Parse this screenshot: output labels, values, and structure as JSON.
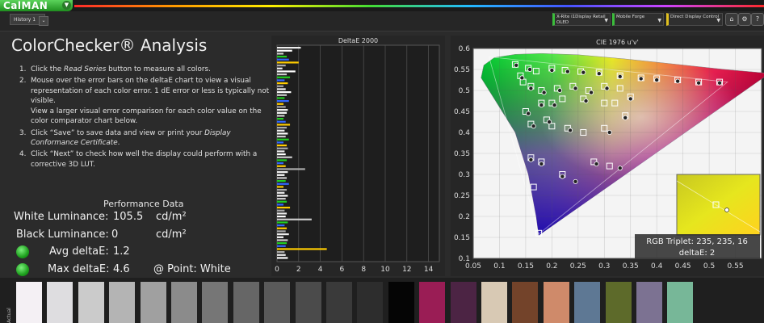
{
  "app": {
    "logo": "CalMAN",
    "history_tab": "History 1",
    "dropdowns": [
      {
        "label": "X-Rite i1Display Retail",
        "sub": "OLED"
      },
      {
        "label": "Mobile Forge",
        "sub": ""
      },
      {
        "label": "Direct Display Control",
        "sub": ""
      }
    ],
    "icons": [
      "home-icon",
      "settings-icon",
      "help-icon"
    ]
  },
  "page": {
    "title": "ColorChecker® Analysis",
    "steps": [
      {
        "num": "1.",
        "html": "Click the <i>Read Series</i> button to measure all colors."
      },
      {
        "num": "2.",
        "html": "Mouse over the error bars on the deltaE chart to view a visual representation of each color error. 1 dE error or less is typically not visible.<br>View a larger visual error comparison for each color value on the color comparator chart below."
      },
      {
        "num": "3.",
        "html": "Click “Save” to save data and view or print your <i>Display Conformance Certificate</i>."
      },
      {
        "num": "4.",
        "html": "Click “Next” to check how well the display could perform with a corrective 3D LUT."
      }
    ]
  },
  "performance": {
    "title": "Performance Data",
    "white_label": "White Luminance:",
    "white_value": "105.5",
    "white_unit": "cd/m²",
    "black_label": "Black Luminance:",
    "black_value": "0",
    "black_unit": "cd/m²",
    "avg_label": "Avg deltaE:",
    "avg_value": "1.2",
    "max_label": "Max deltaE:",
    "max_value": "4.6",
    "point_label": "@ Point: White",
    "status_color": "#22b022"
  },
  "chart_data": [
    {
      "type": "bar",
      "orientation": "horizontal",
      "title": "DeltaE 2000",
      "xlim": [
        0,
        15
      ],
      "xticks": [
        "0",
        "2",
        "4",
        "6",
        "8",
        "10",
        "12",
        "14"
      ],
      "values": [
        2.2,
        1.4,
        0.6,
        0.9,
        1.1,
        2.0,
        0.8,
        0.5,
        1.7,
        0.9,
        1.2,
        0.7,
        1.0,
        0.6,
        0.8,
        1.3,
        0.9,
        0.7,
        1.1,
        0.6,
        0.8,
        1.0,
        0.9,
        0.7,
        0.6,
        0.8,
        1.2,
        0.9,
        0.7,
        1.0,
        0.8,
        1.1,
        0.6,
        0.9,
        1.0,
        0.7,
        0.8,
        1.4,
        0.9,
        0.6,
        0.8,
        2.6,
        1.0,
        0.7,
        0.9,
        0.8,
        1.1,
        0.6,
        0.9,
        0.7,
        1.0,
        0.8,
        0.9,
        0.6,
        1.2,
        0.7,
        0.9,
        0.8,
        3.2,
        1.0,
        0.7,
        0.9,
        0.8,
        1.1,
        0.6,
        1.0,
        0.9,
        0.8,
        4.6,
        0.7,
        0.8,
        1.0
      ],
      "bar_colors": [
        "#eeeeee",
        "#ffffff",
        "#cccccc",
        "#22cc22",
        "#3366ff",
        "#ffcc00",
        "#aaaaaa"
      ]
    },
    {
      "type": "scatter",
      "title": "CIE 1976 u'v'",
      "xlim": [
        0.05,
        0.6
      ],
      "ylim": [
        0.1,
        0.6
      ],
      "xticks": [
        "0.05",
        "0.1",
        "0.15",
        "0.2",
        "0.25",
        "0.3",
        "0.35",
        "0.4",
        "0.45",
        "0.5",
        "0.55"
      ],
      "yticks": [
        "0.6",
        "0.55",
        "0.5",
        "0.45",
        "0.4",
        "0.35",
        "0.3",
        "0.25",
        "0.2",
        "0.15",
        "0.1"
      ],
      "targets": [
        [
          0.13,
          0.562
        ],
        [
          0.155,
          0.553
        ],
        [
          0.17,
          0.546
        ],
        [
          0.2,
          0.553
        ],
        [
          0.225,
          0.548
        ],
        [
          0.255,
          0.545
        ],
        [
          0.29,
          0.543
        ],
        [
          0.33,
          0.535
        ],
        [
          0.37,
          0.53
        ],
        [
          0.4,
          0.528
        ],
        [
          0.44,
          0.525
        ],
        [
          0.48,
          0.52
        ],
        [
          0.52,
          0.52
        ],
        [
          0.14,
          0.535
        ],
        [
          0.145,
          0.52
        ],
        [
          0.16,
          0.51
        ],
        [
          0.18,
          0.5
        ],
        [
          0.21,
          0.505
        ],
        [
          0.24,
          0.51
        ],
        [
          0.27,
          0.5
        ],
        [
          0.3,
          0.51
        ],
        [
          0.33,
          0.505
        ],
        [
          0.35,
          0.485
        ],
        [
          0.18,
          0.47
        ],
        [
          0.2,
          0.47
        ],
        [
          0.22,
          0.48
        ],
        [
          0.26,
          0.48
        ],
        [
          0.3,
          0.47
        ],
        [
          0.32,
          0.47
        ],
        [
          0.15,
          0.45
        ],
        [
          0.16,
          0.42
        ],
        [
          0.19,
          0.43
        ],
        [
          0.2,
          0.415
        ],
        [
          0.23,
          0.41
        ],
        [
          0.26,
          0.4
        ],
        [
          0.3,
          0.41
        ],
        [
          0.34,
          0.44
        ],
        [
          0.16,
          0.34
        ],
        [
          0.18,
          0.33
        ],
        [
          0.22,
          0.3
        ],
        [
          0.28,
          0.33
        ],
        [
          0.31,
          0.32
        ],
        [
          0.165,
          0.27
        ],
        [
          0.175,
          0.16
        ]
      ],
      "measured": [
        [
          0.132,
          0.56
        ],
        [
          0.158,
          0.55
        ],
        [
          0.2,
          0.548
        ],
        [
          0.23,
          0.545
        ],
        [
          0.26,
          0.543
        ],
        [
          0.29,
          0.54
        ],
        [
          0.33,
          0.533
        ],
        [
          0.37,
          0.528
        ],
        [
          0.4,
          0.525
        ],
        [
          0.44,
          0.522
        ],
        [
          0.48,
          0.518
        ],
        [
          0.52,
          0.518
        ],
        [
          0.143,
          0.53
        ],
        [
          0.16,
          0.505
        ],
        [
          0.185,
          0.495
        ],
        [
          0.215,
          0.5
        ],
        [
          0.245,
          0.505
        ],
        [
          0.275,
          0.495
        ],
        [
          0.305,
          0.505
        ],
        [
          0.35,
          0.48
        ],
        [
          0.18,
          0.465
        ],
        [
          0.205,
          0.465
        ],
        [
          0.265,
          0.475
        ],
        [
          0.155,
          0.445
        ],
        [
          0.165,
          0.415
        ],
        [
          0.195,
          0.425
        ],
        [
          0.235,
          0.405
        ],
        [
          0.31,
          0.4
        ],
        [
          0.34,
          0.435
        ],
        [
          0.16,
          0.335
        ],
        [
          0.22,
          0.295
        ],
        [
          0.245,
          0.283
        ],
        [
          0.285,
          0.325
        ],
        [
          0.33,
          0.315
        ],
        [
          0.18,
          0.325
        ]
      ],
      "inset": {
        "triplet_label": "RGB Triplet: 235, 235, 16",
        "delta_label": "deltaE: 2"
      }
    }
  ],
  "comparator": {
    "label": "Actual",
    "swatches": [
      "#f4f0f4",
      "#dedde0",
      "#cbcbcb",
      "#b4b4b4",
      "#a0a0a0",
      "#8b8b8b",
      "#767676",
      "#666666",
      "#5a5a5a",
      "#4b4b4b",
      "#3a3a3a",
      "#2d2d2d",
      "#050505",
      "#9a1d55",
      "#4c2444",
      "#d8c9b4",
      "#73432a",
      "#cf8a6a",
      "#5e7894",
      "#5d6a2a",
      "#7c7292",
      "#77b798"
    ]
  }
}
